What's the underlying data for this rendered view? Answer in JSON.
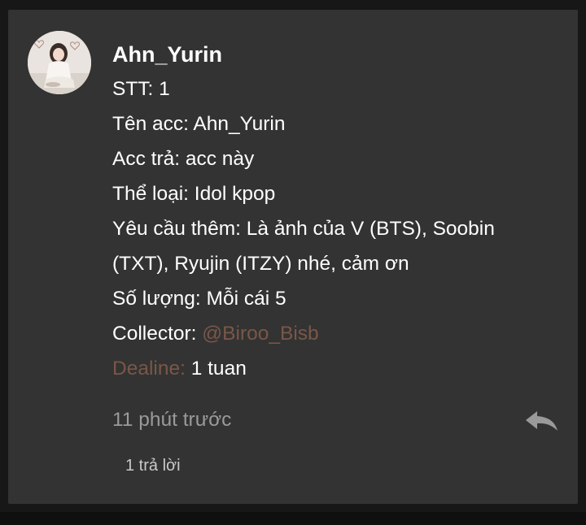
{
  "comment": {
    "author": "Ahn_Yurin",
    "lines": {
      "stt": "STT: 1",
      "ten_acc": "Tên acc: Ahn_Yurin",
      "acc_tra": "Acc trả: acc này",
      "the_loai": "Thể loại: Idol kpop",
      "yeu_cau": "Yêu cầu thêm: Là ảnh của V (BTS), Soobin (TXT), Ryujin (ITZY) nhé, cảm ơn",
      "so_luong": "Số lượng: Mỗi cái 5",
      "collector_label": "Collector: ",
      "collector_mention": "@Biroo_Bisb",
      "deadline_label": "Dealine:",
      "deadline_value": " 1 tuan"
    },
    "timestamp": "11 phút trước",
    "replies_label": "1 trả lời",
    "reply_icon": "reply-arrow-icon"
  },
  "colors": {
    "card_bg": "#333333",
    "page_bg": "#171717",
    "accent": "#7a5748",
    "muted_text": "#9a9a9a"
  }
}
